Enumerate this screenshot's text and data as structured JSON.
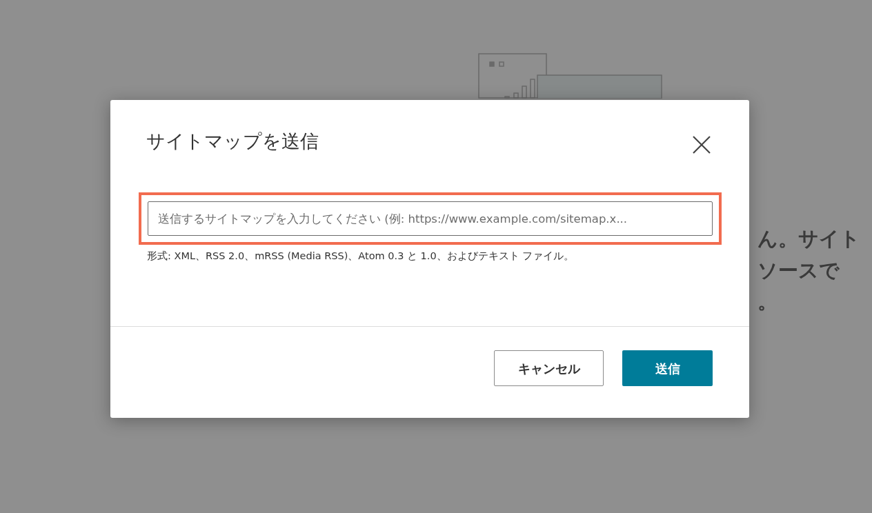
{
  "background": {
    "text_lines": [
      "ん。サイト",
      "ソースで",
      "。"
    ]
  },
  "dialog": {
    "title": "サイトマップを送信",
    "input": {
      "placeholder": "送信するサイトマップを入力してください (例: https://www.example.com/sitemap.x...",
      "highlighted": true
    },
    "hint": "形式: XML、RSS 2.0、mRSS (Media RSS)、Atom 0.3 と 1.0、およびテキスト ファイル。",
    "buttons": [
      {
        "label": "キャンセル",
        "kind": "secondary"
      },
      {
        "label": "送信",
        "kind": "primary"
      }
    ]
  }
}
